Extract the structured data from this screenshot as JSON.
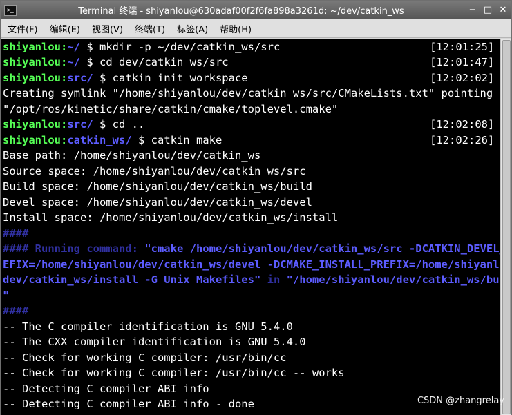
{
  "window": {
    "title": "Terminal 终端 - shiyanlou@630adaf00f2f6fa898a3261d: ~/dev/catkin_ws",
    "icon_label": ">_",
    "controls": [
      "−",
      "□",
      "✕"
    ]
  },
  "menubar": {
    "items": [
      "文件(F)",
      "编辑(E)",
      "视图(V)",
      "终端(T)",
      "标签(A)",
      "帮助(H)"
    ]
  },
  "terminal": {
    "user": "shiyanlou:",
    "commands": [
      {
        "dir": "~/",
        "cmd": " $ mkdir -p ~/dev/catkin_ws/src",
        "time": "[12:01:25]"
      },
      {
        "dir": "~/",
        "cmd": " $ cd dev/catkin_ws/src",
        "time": "[12:01:47]"
      },
      {
        "dir": "src/",
        "cmd": " $ catkin_init_workspace",
        "time": "[12:02:02]"
      },
      {
        "dir": "src/",
        "cmd": " $ cd ..",
        "time": "[12:02:08]"
      },
      {
        "dir": "catkin_ws/",
        "cmd": " $ catkin_make",
        "time": "[12:02:26]"
      }
    ],
    "symlink_lines": [
      "Creating symlink \"/home/shiyanlou/dev/catkin_ws/src/CMakeLists.txt\" pointing to",
      "\"/opt/ros/kinetic/share/catkin/cmake/toplevel.cmake\""
    ],
    "paths": [
      "Base path: /home/shiyanlou/dev/catkin_ws",
      "Source space: /home/shiyanlou/dev/catkin_ws/src",
      "Build space: /home/shiyanlou/dev/catkin_ws/build",
      "Devel space: /home/shiyanlou/dev/catkin_ws/devel",
      "Install space: /home/shiyanlou/dev/catkin_ws/install"
    ],
    "hash_line": "####",
    "running_prefix": "#### Running command: ",
    "running_cmd": [
      "\"cmake /home/shiyanlou/dev/catkin_ws/src -DCATKIN_DEVEL_PR",
      "EFIX=/home/shiyanlou/dev/catkin_ws/devel -DCMAKE_INSTALL_PREFIX=/home/shiyanlou/",
      "dev/catkin_ws/install -G Unix Makefiles\""
    ],
    "in_word": " in ",
    "running_dir": [
      "\"/home/shiyanlou/dev/catkin_ws/build",
      "\""
    ],
    "cmake_output": [
      "-- The C compiler identification is GNU 5.4.0",
      "-- The CXX compiler identification is GNU 5.4.0",
      "-- Check for working C compiler: /usr/bin/cc",
      "-- Check for working C compiler: /usr/bin/cc -- works",
      "-- Detecting C compiler ABI info",
      "-- Detecting C compiler ABI info - done"
    ]
  },
  "watermark": "CSDN @zhangrelay",
  "colors": {
    "prompt_user": "#55ff55",
    "prompt_dir": "#5c5cff",
    "background": "#000000",
    "text": "#ffffff"
  }
}
